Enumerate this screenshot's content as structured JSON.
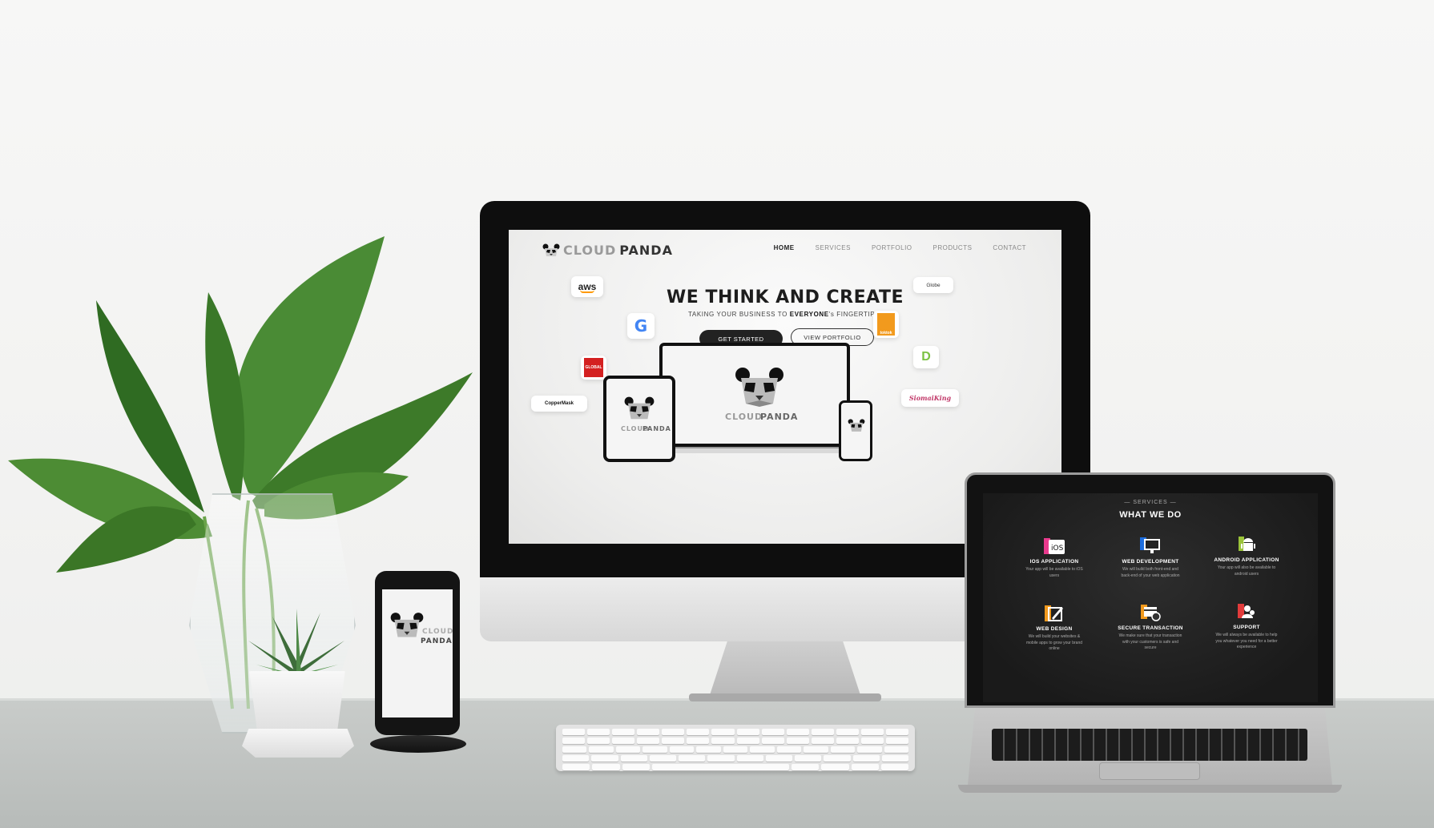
{
  "site": {
    "logo_part1": "CLOUD",
    "logo_part2": "PANDA",
    "nav": [
      {
        "label": "HOME",
        "active": true
      },
      {
        "label": "SERVICES",
        "active": false
      },
      {
        "label": "PORTFOLIO",
        "active": false
      },
      {
        "label": "PRODUCTS",
        "active": false
      },
      {
        "label": "CONTACT",
        "active": false
      }
    ],
    "hero": {
      "title": "WE THINK AND CREATE",
      "subtitle_pre": "TAKING YOUR BUSINESS TO ",
      "subtitle_bold": "EVERYONE",
      "subtitle_post": "'s FINGERTIPS.",
      "primary_button": "GET STARTED",
      "secondary_button": "VIEW PORTFOLIO"
    },
    "clients": {
      "aws": "aws",
      "google": "G",
      "global": "GLOBAL",
      "copper": "CopperMask",
      "globe": "Globe",
      "toktok": "toktok",
      "d_logo": "D",
      "siomai": "SiomaiKing"
    },
    "device_brand_1": "CLOUD",
    "device_brand_2": "PANDA"
  },
  "services": {
    "kicker": "— SERVICES —",
    "title": "WHAT WE DO",
    "items": [
      {
        "name": "IOS APPLICATION",
        "desc": "Your app will be available to iOS users",
        "icon": "ios-icon",
        "color": "#e93a8d"
      },
      {
        "name": "WEB DEVELOPMENT",
        "desc": "We will build both front-end and back-end of your web application",
        "icon": "monitor-icon",
        "color": "#1e6fe0"
      },
      {
        "name": "ANDROID APPLICATION",
        "desc": "Your app will also be available to android users",
        "icon": "android-icon",
        "color": "#9bc43a"
      },
      {
        "name": "WEB DESIGN",
        "desc": "We will build your websites & mobile apps to grow your brand online",
        "icon": "design-icon",
        "color": "#f29a1d"
      },
      {
        "name": "SECURE TRANSACTION",
        "desc": "We make sure that your transaction with your customers is safe and secure",
        "icon": "secure-icon",
        "color": "#f29a1d"
      },
      {
        "name": "SUPPORT",
        "desc": "We will always be available to help you whatever you need for a better experience",
        "icon": "support-icon",
        "color": "#e23b3b"
      }
    ]
  }
}
